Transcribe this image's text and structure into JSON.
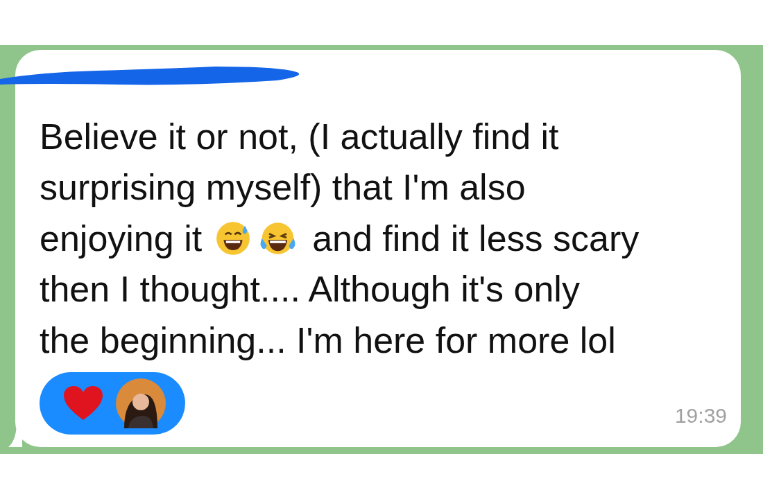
{
  "message": {
    "lines": [
      [
        {
          "kind": "text",
          "text": "Believe it or not, (I actually find it"
        }
      ],
      [
        {
          "kind": "text",
          "text": "surprising myself) that I'm also"
        }
      ],
      [
        {
          "kind": "text",
          "text": "enjoying it"
        },
        {
          "kind": "sweat-emoji"
        },
        {
          "kind": "joy-emoji"
        },
        {
          "kind": "text",
          "text": "and find it less scary"
        }
      ],
      [
        {
          "kind": "text",
          "text": "then I thought.... Although it's only"
        }
      ],
      [
        {
          "kind": "text",
          "text": "the beginning... I'm here for more lol"
        }
      ]
    ],
    "reactions": [
      {
        "kind": "heart"
      },
      {
        "kind": "avatar"
      }
    ],
    "time": "19:39"
  }
}
